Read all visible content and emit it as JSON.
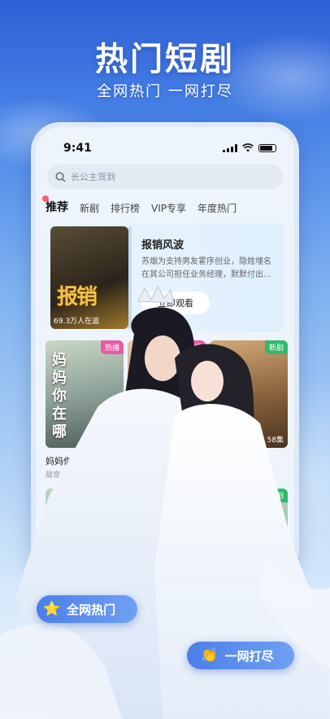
{
  "hero": {
    "title": "热门短剧",
    "subtitle": "全网热门 一网打尽"
  },
  "status": {
    "time": "9:41"
  },
  "search": {
    "placeholder": "长公主驾到"
  },
  "tabs": [
    "推荐",
    "新剧",
    "排行榜",
    "VIP专享",
    "年度热门"
  ],
  "feature": {
    "title": "报销风波",
    "desc": "苏烟为支持男友霍序创业，隐姓埋名在其公司担任业务经理，默默付出...",
    "button": "立即观看",
    "poster_text": "报销",
    "favorites": "69.3万人在追"
  },
  "cards": [
    {
      "badge": "热播",
      "poster_text": "妈妈你在哪",
      "caption": "妈妈你",
      "tags": "甜宠 偶"
    },
    {
      "badge": "热播"
    },
    {
      "badge": "新剧",
      "episodes": "58集"
    },
    {
      "badge": ""
    },
    {
      "badge": "新剧"
    }
  ],
  "pills": [
    {
      "icon": "star-icon",
      "label": "全网热门"
    },
    {
      "icon": "clap-icon",
      "label": "一网打尽"
    }
  ],
  "colors": {
    "accent": "#4b7fe8",
    "hot_badge": "#e85aa7",
    "new_badge": "#2fb96a"
  }
}
